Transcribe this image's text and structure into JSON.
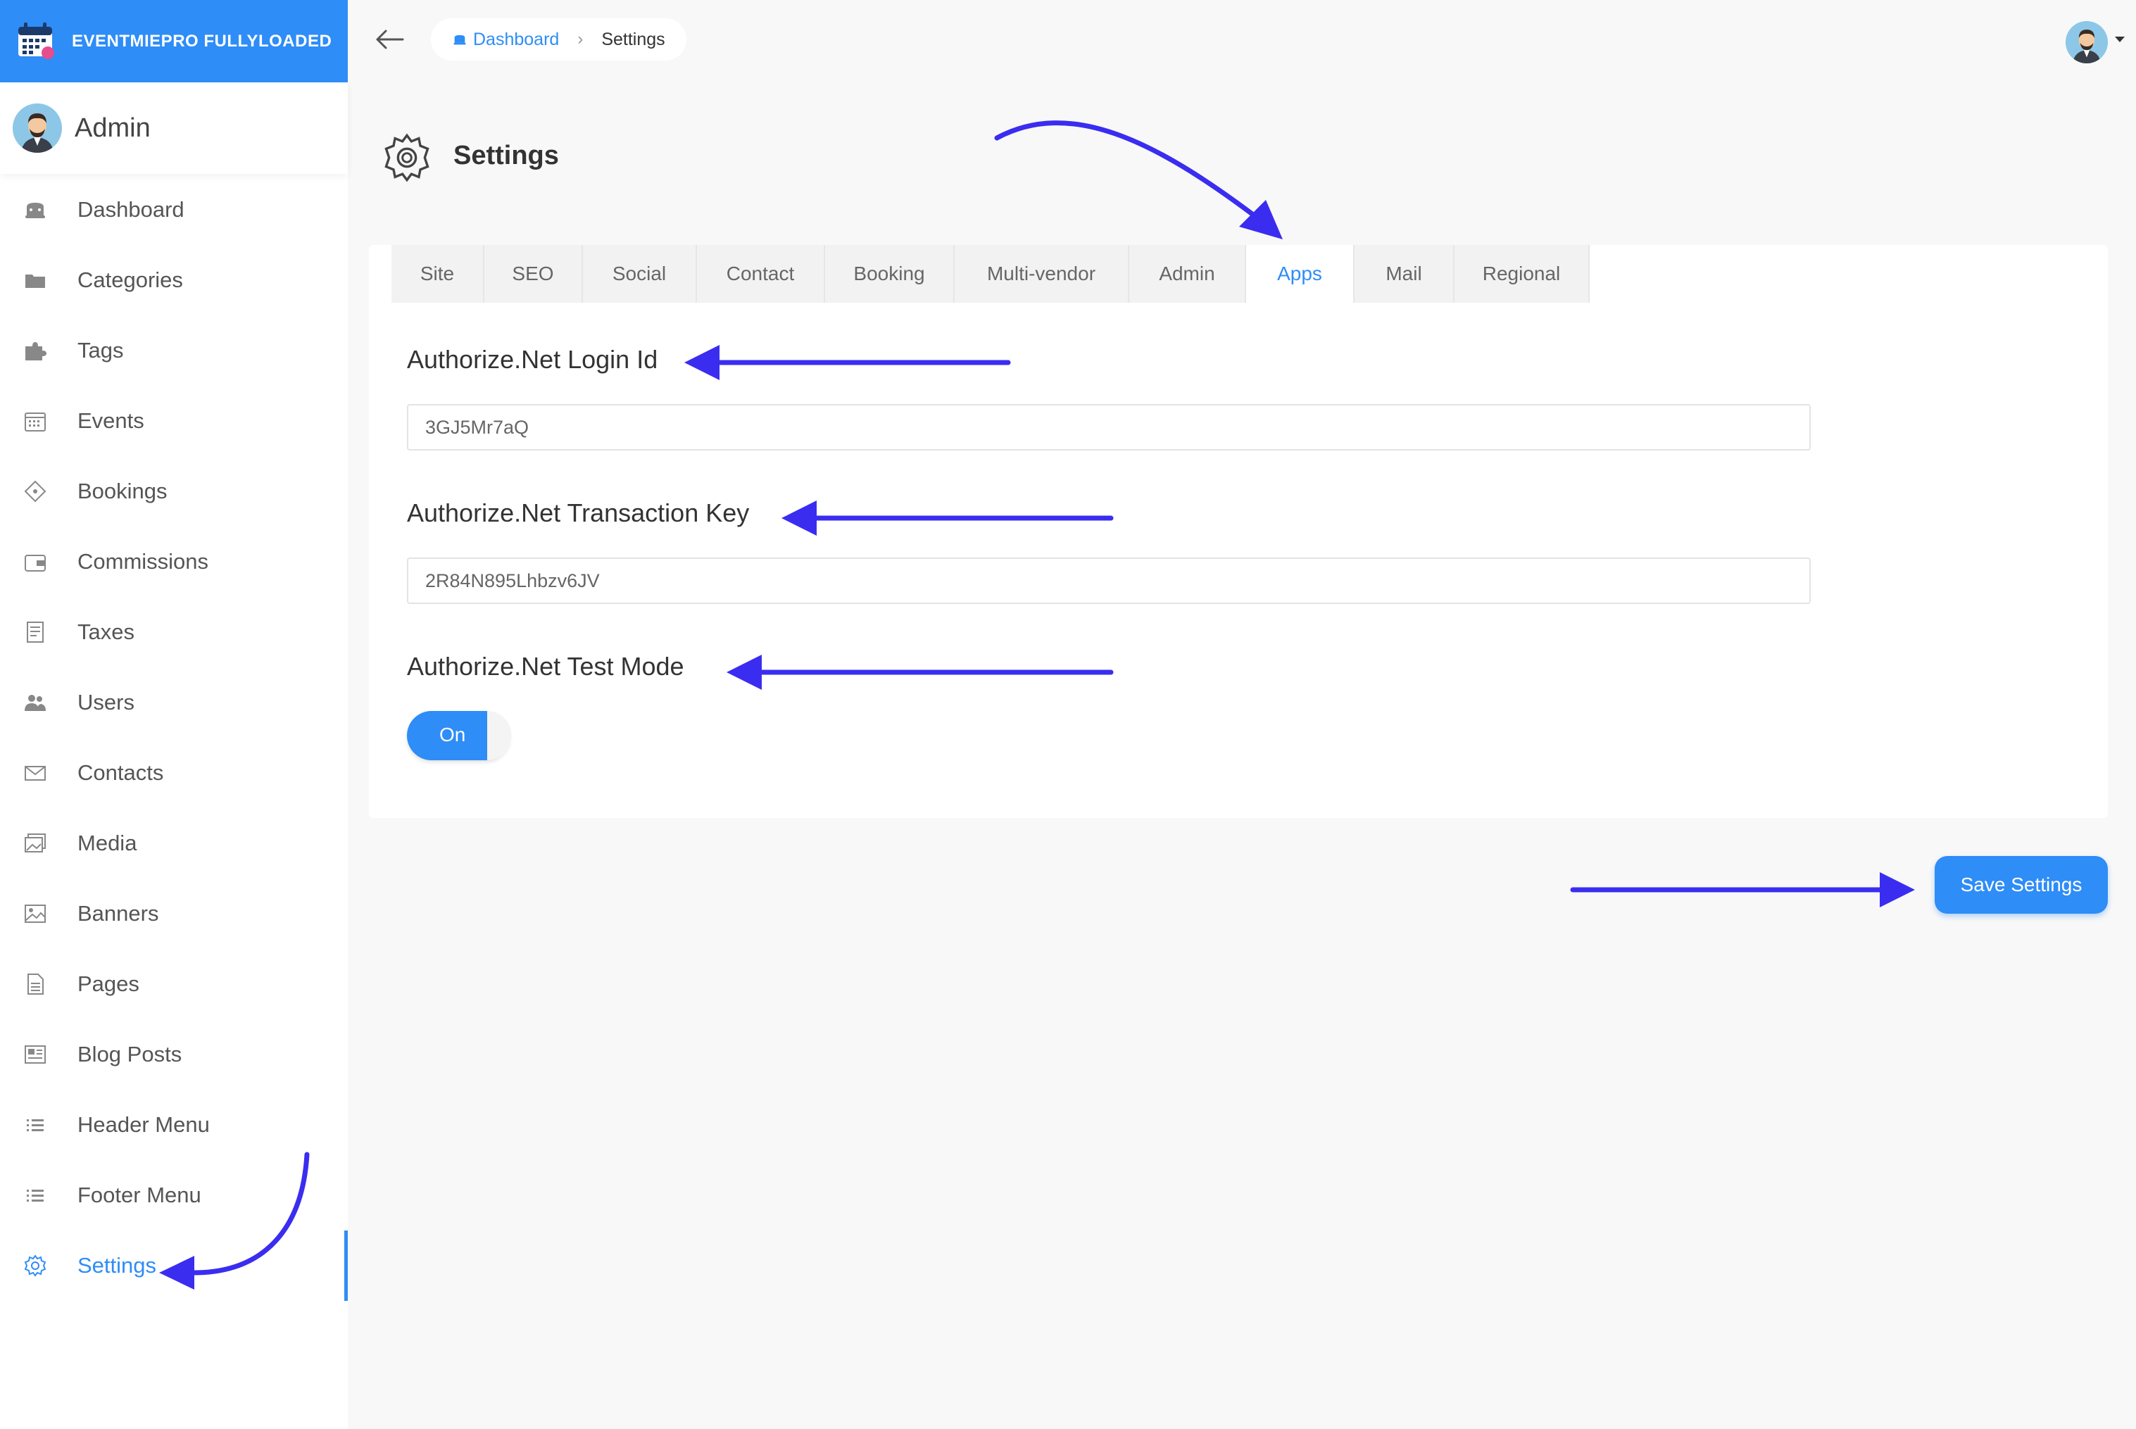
{
  "brand": {
    "title": "EVENTMIEPRO FULLYLOADED"
  },
  "user": {
    "name": "Admin"
  },
  "sidebar": {
    "items": [
      {
        "label": "Dashboard",
        "icon": "dashboard-icon"
      },
      {
        "label": "Categories",
        "icon": "folder-icon"
      },
      {
        "label": "Tags",
        "icon": "puzzle-icon"
      },
      {
        "label": "Events",
        "icon": "calendar-icon"
      },
      {
        "label": "Bookings",
        "icon": "ticket-icon"
      },
      {
        "label": "Commissions",
        "icon": "wallet-icon"
      },
      {
        "label": "Taxes",
        "icon": "receipt-icon"
      },
      {
        "label": "Users",
        "icon": "users-icon"
      },
      {
        "label": "Contacts",
        "icon": "envelope-icon"
      },
      {
        "label": "Media",
        "icon": "images-icon"
      },
      {
        "label": "Banners",
        "icon": "image-icon"
      },
      {
        "label": "Pages",
        "icon": "page-icon"
      },
      {
        "label": "Blog Posts",
        "icon": "newspaper-icon"
      },
      {
        "label": "Header Menu",
        "icon": "list-icon"
      },
      {
        "label": "Footer Menu",
        "icon": "list-icon"
      },
      {
        "label": "Settings",
        "icon": "gear-icon",
        "active": true
      }
    ]
  },
  "breadcrumb": {
    "home": "Dashboard",
    "current": "Settings"
  },
  "page": {
    "title": "Settings"
  },
  "tabs": [
    {
      "label": "Site"
    },
    {
      "label": "SEO"
    },
    {
      "label": "Social"
    },
    {
      "label": "Contact"
    },
    {
      "label": "Booking"
    },
    {
      "label": "Multi-vendor"
    },
    {
      "label": "Admin"
    },
    {
      "label": "Apps",
      "active": true
    },
    {
      "label": "Mail"
    },
    {
      "label": "Regional"
    }
  ],
  "form": {
    "login_id_label": "Authorize.Net Login Id",
    "login_id_value": "3GJ5Mr7aQ",
    "transaction_key_label": "Authorize.Net Transaction Key",
    "transaction_key_value": "2R84N895Lhbzv6JV",
    "test_mode_label": "Authorize.Net Test Mode",
    "test_mode_value": "On"
  },
  "actions": {
    "save_label": "Save Settings"
  },
  "colors": {
    "accent": "#2e8df7",
    "annotation_arrow": "#3a2df0"
  }
}
